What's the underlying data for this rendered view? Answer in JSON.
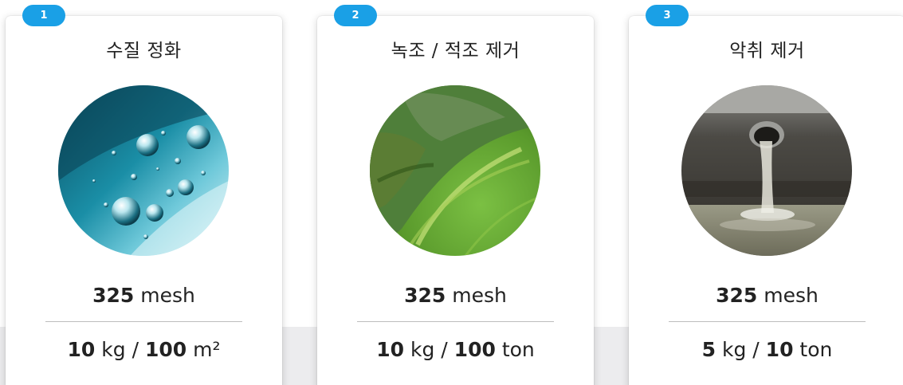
{
  "cards": [
    {
      "badge": "1",
      "title": "수질 정화",
      "image_icon": "water-bubbles-photo",
      "mesh_value": "325",
      "mesh_unit": "mesh",
      "dose_amount": "10",
      "dose_unit": "kg",
      "dose_sep": "/",
      "dose_per": "100",
      "dose_per_unit": "m²"
    },
    {
      "badge": "2",
      "title": "녹조 / 적조 제거",
      "image_icon": "green-algae-photo",
      "mesh_value": "325",
      "mesh_unit": "mesh",
      "dose_amount": "10",
      "dose_unit": "kg",
      "dose_sep": "/",
      "dose_per": "100",
      "dose_per_unit": "ton"
    },
    {
      "badge": "3",
      "title": "악취 제거",
      "image_icon": "drain-pipe-photo",
      "mesh_value": "325",
      "mesh_unit": "mesh",
      "dose_amount": "5",
      "dose_unit": "kg",
      "dose_sep": "/",
      "dose_per": "10",
      "dose_per_unit": "ton"
    }
  ],
  "colors": {
    "badge": "#1aa0e6",
    "text": "#222222",
    "divider": "#bdbdbd",
    "floor": "#ececee"
  }
}
